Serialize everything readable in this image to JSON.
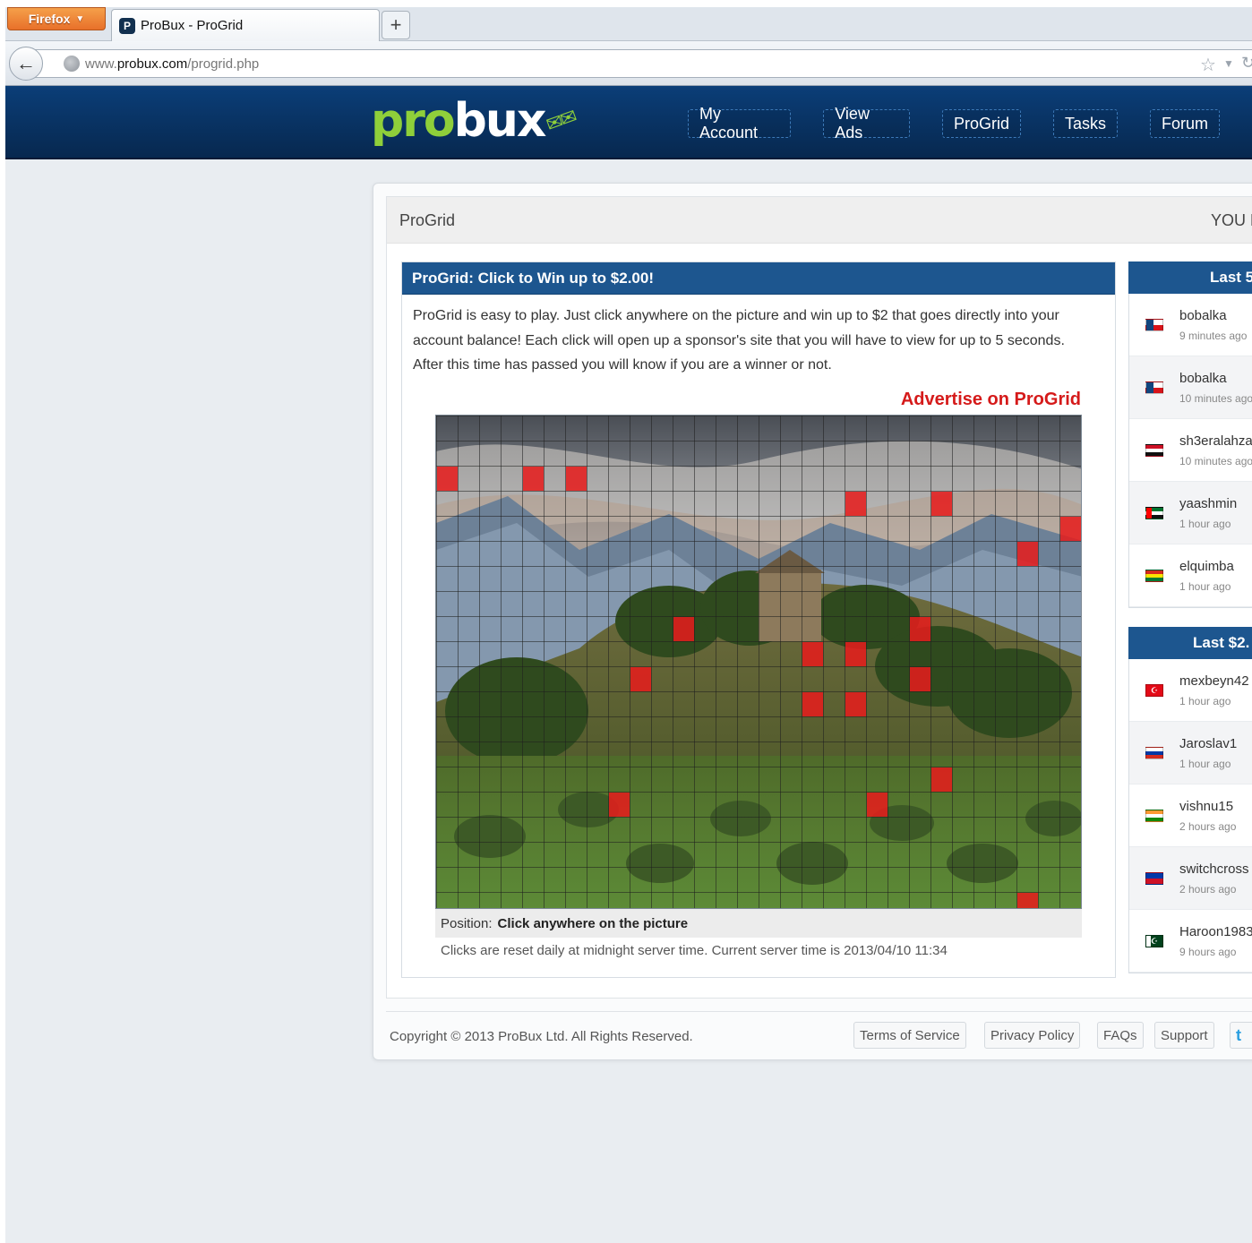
{
  "browser": {
    "menu_label": "Firefox",
    "tab_title": "ProBux - ProGrid",
    "tab_favicon": "P",
    "new_tab": "+",
    "url_prefix": "www.",
    "url_host": "probux.com",
    "url_path": "/progrid.php"
  },
  "site": {
    "logo_pro": "pro",
    "logo_bux": "bux",
    "nav": [
      "My Account",
      "View Ads",
      "ProGrid",
      "Tasks",
      "Forum"
    ]
  },
  "page": {
    "title": "ProGrid",
    "title_right": "YOU H"
  },
  "progrid": {
    "heading": "ProGrid: Click to Win up to $2.00!",
    "desc_1": "ProGrid is easy to play. Just click anywhere on the picture and win up to $2 that goes directly into your account balance! Each click will open up a sponsor's site that you will have to view for up to 5 seconds.",
    "desc_2": "After this time has passed you will know if you are a winner or not.",
    "advertise": "Advertise on ProGrid",
    "position_label": "Position:",
    "position_value": "Click anywhere on the picture",
    "clicks_note": "Clicks are reset daily at midnight server time. Current server time is 2013/04/10 11:34",
    "grid_cols": 30,
    "grid_rows": 20,
    "clicked_cells": [
      [
        0,
        2
      ],
      [
        4,
        2
      ],
      [
        6,
        2
      ],
      [
        19,
        3
      ],
      [
        23,
        3
      ],
      [
        29,
        4
      ],
      [
        27,
        5
      ],
      [
        22,
        8
      ],
      [
        11,
        8
      ],
      [
        17,
        9
      ],
      [
        19,
        9
      ],
      [
        9,
        10
      ],
      [
        22,
        10
      ],
      [
        17,
        11
      ],
      [
        19,
        11
      ],
      [
        23,
        14
      ],
      [
        8,
        15
      ],
      [
        20,
        15
      ],
      [
        27,
        19
      ]
    ]
  },
  "sidebar": {
    "winners_title": "Last 5",
    "winners": [
      {
        "user": "bobalka",
        "time": "9 minutes ago",
        "flag": "cz"
      },
      {
        "user": "bobalka",
        "time": "10 minutes ago",
        "flag": "cz"
      },
      {
        "user": "sh3eralahza",
        "time": "10 minutes ago",
        "flag": "eg"
      },
      {
        "user": "yaashmin",
        "time": "1 hour ago",
        "flag": "ae"
      },
      {
        "user": "elquimba",
        "time": "1 hour ago",
        "flag": "bo"
      }
    ],
    "big_winners_title": "Last $2.",
    "big_winners": [
      {
        "user": "mexbeyn42",
        "time": "1 hour ago",
        "flag": "tr"
      },
      {
        "user": "Jaroslav1",
        "time": "1 hour ago",
        "flag": "ru"
      },
      {
        "user": "vishnu15",
        "time": "2 hours ago",
        "flag": "in"
      },
      {
        "user": "switchcross",
        "time": "2 hours ago",
        "flag": "ph"
      },
      {
        "user": "Haroon1983",
        "time": "9 hours ago",
        "flag": "pk"
      }
    ]
  },
  "footer": {
    "copyright": "Copyright © 2013 ProBux Ltd. All Rights Reserved.",
    "links": [
      "Terms of Service",
      "Privacy Policy",
      "FAQs",
      "Support"
    ],
    "twitter": "t"
  },
  "colors": {
    "header_bg": "#0b3e78",
    "logo_green": "#8fcf3a",
    "panel_blue": "#1d568f",
    "advertise_red": "#d51a1a"
  }
}
